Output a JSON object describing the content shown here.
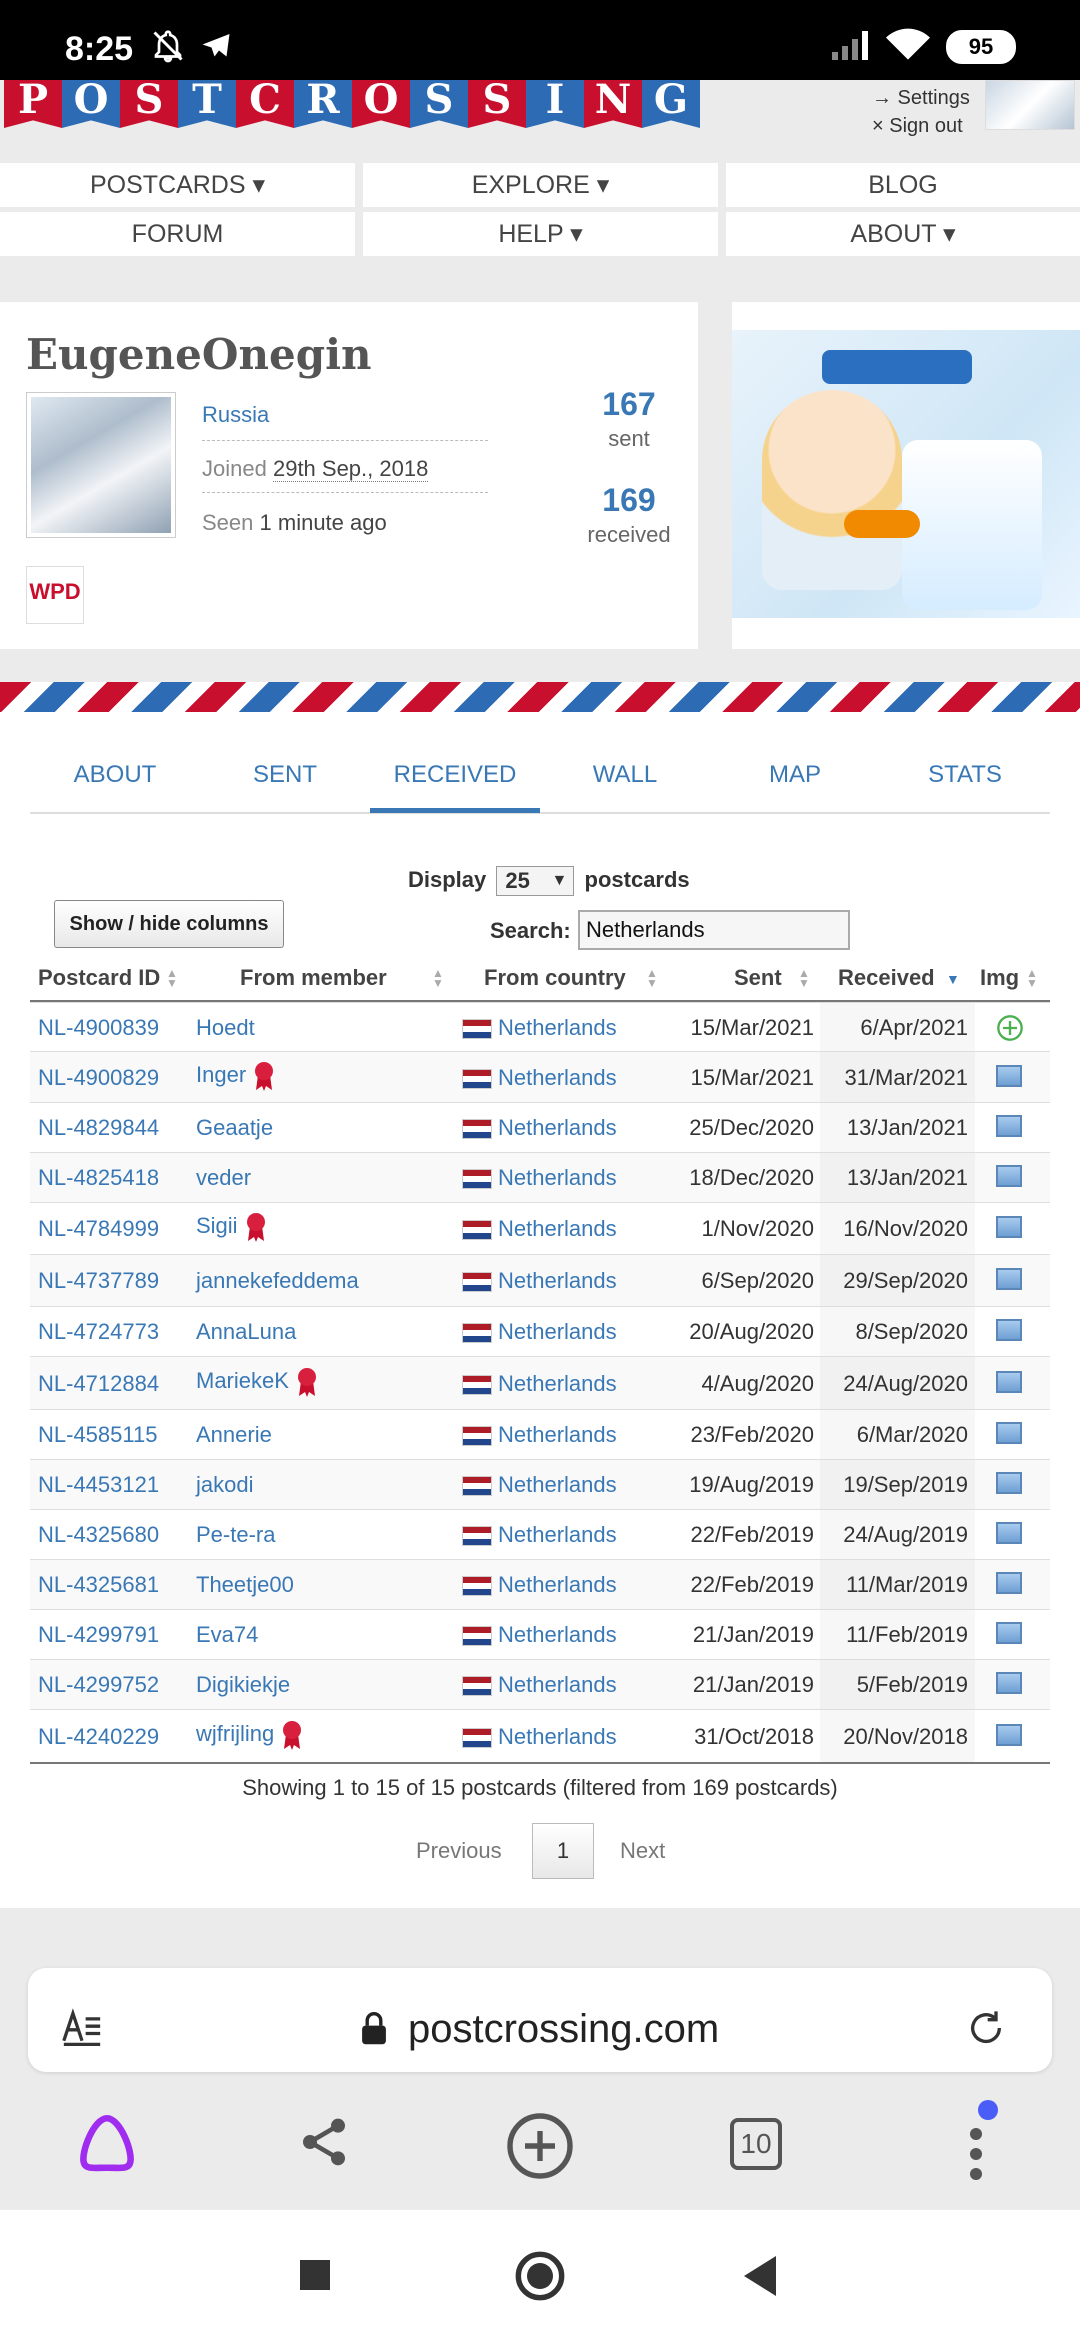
{
  "status_bar": {
    "time": "8:25",
    "battery": "95"
  },
  "header": {
    "logo_letters": [
      "P",
      "O",
      "S",
      "T",
      "C",
      "R",
      "O",
      "S",
      "S",
      "I",
      "N",
      "G"
    ],
    "settings_link": "→ Settings",
    "signout_link": "× Sign out"
  },
  "nav": {
    "postcards": "POSTCARDS ▾",
    "explore": "EXPLORE ▾",
    "blog": "BLOG",
    "forum": "FORUM",
    "help": "HELP ▾",
    "about": "ABOUT ▾"
  },
  "profile": {
    "username": "EugeneOnegin",
    "country": "Russia",
    "joined_label": "Joined",
    "joined_date": "29th Sep., 2018",
    "seen_label": "Seen",
    "seen_value": "1 minute ago",
    "sent_count": "167",
    "sent_label": "sent",
    "received_count": "169",
    "received_label": "received",
    "badge": "WPD"
  },
  "tabs": {
    "about": "ABOUT",
    "sent": "SENT",
    "received": "RECEIVED",
    "wall": "WALL",
    "map": "MAP",
    "stats": "STATS"
  },
  "controls": {
    "display_label": "Display",
    "page_size": "25",
    "postcards_label": "postcards",
    "show_hide": "Show / hide columns",
    "search_label": "Search:",
    "search_value": "Netherlands"
  },
  "table": {
    "headers": {
      "id": "Postcard ID",
      "member": "From member",
      "country": "From country",
      "sent": "Sent",
      "received": "Received",
      "img": "Img"
    },
    "rows": [
      {
        "id": "NL-4900839",
        "member": "Hoedt",
        "country": "Netherlands",
        "sent": "15/Mar/2021",
        "received": "6/Apr/2021"
      },
      {
        "id": "NL-4900829",
        "member": "Inger",
        "country": "Netherlands",
        "sent": "15/Mar/2021",
        "received": "31/Mar/2021"
      },
      {
        "id": "NL-4829844",
        "member": "Geaatje",
        "country": "Netherlands",
        "sent": "25/Dec/2020",
        "received": "13/Jan/2021"
      },
      {
        "id": "NL-4825418",
        "member": "veder",
        "country": "Netherlands",
        "sent": "18/Dec/2020",
        "received": "13/Jan/2021"
      },
      {
        "id": "NL-4784999",
        "member": "Sigii",
        "country": "Netherlands",
        "sent": "1/Nov/2020",
        "received": "16/Nov/2020"
      },
      {
        "id": "NL-4737789",
        "member": "jannekefeddema",
        "country": "Netherlands",
        "sent": "6/Sep/2020",
        "received": "29/Sep/2020"
      },
      {
        "id": "NL-4724773",
        "member": "AnnaLuna",
        "country": "Netherlands",
        "sent": "20/Aug/2020",
        "received": "8/Sep/2020"
      },
      {
        "id": "NL-4712884",
        "member": "MariekeK",
        "country": "Netherlands",
        "sent": "4/Aug/2020",
        "received": "24/Aug/2020"
      },
      {
        "id": "NL-4585115",
        "member": "Annerie",
        "country": "Netherlands",
        "sent": "23/Feb/2020",
        "received": "6/Mar/2020"
      },
      {
        "id": "NL-4453121",
        "member": "jakodi",
        "country": "Netherlands",
        "sent": "19/Aug/2019",
        "received": "19/Sep/2019"
      },
      {
        "id": "NL-4325680",
        "member": "Pe-te-ra",
        "country": "Netherlands",
        "sent": "22/Feb/2019",
        "received": "24/Aug/2019"
      },
      {
        "id": "NL-4325681",
        "member": "Theetje00",
        "country": "Netherlands",
        "sent": "22/Feb/2019",
        "received": "11/Mar/2019"
      },
      {
        "id": "NL-4299791",
        "member": "Eva74",
        "country": "Netherlands",
        "sent": "21/Jan/2019",
        "received": "11/Feb/2019"
      },
      {
        "id": "NL-4299752",
        "member": "Digikiekje",
        "country": "Netherlands",
        "sent": "21/Jan/2019",
        "received": "5/Feb/2019"
      },
      {
        "id": "NL-4240229",
        "member": "wjfrijling",
        "country": "Netherlands",
        "sent": "31/Oct/2018",
        "received": "20/Nov/2018"
      }
    ],
    "summary": "Showing 1 to 15 of 15 postcards (filtered from 169 postcards)"
  },
  "pager": {
    "previous": "Previous",
    "page": "1",
    "next": "Next"
  },
  "browser": {
    "url": "postcrossing.com",
    "tab_count": "10"
  },
  "colors": {
    "link": "#3978b5",
    "airmail_red": "#c8102e",
    "airmail_blue": "#2d6bb5"
  }
}
